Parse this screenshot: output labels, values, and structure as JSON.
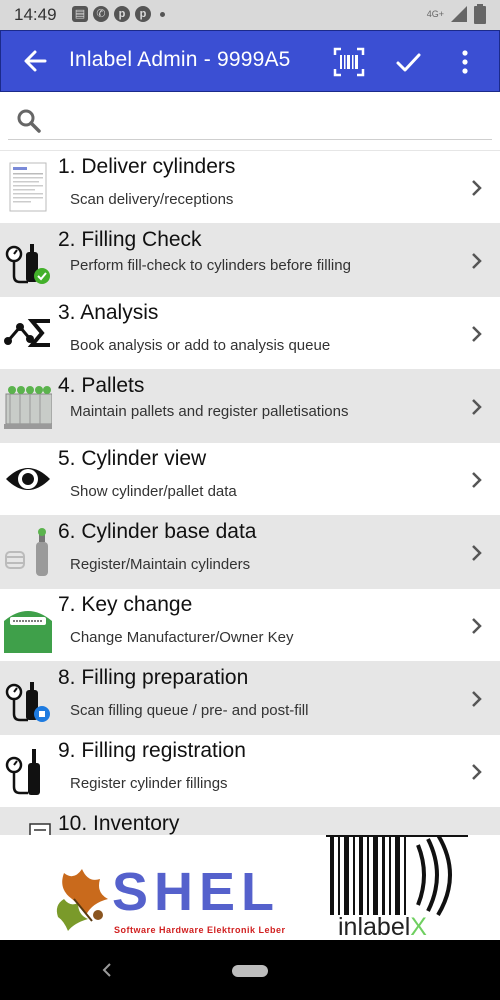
{
  "status_bar": {
    "time": "14:49",
    "network": "4G+",
    "notification_icons": [
      "message-icon",
      "whatsapp-icon",
      "pinterest-icon",
      "pinterest-icon"
    ]
  },
  "app_bar": {
    "title": "Inlabel Admin - 9999A5",
    "accent": "#3b4fd3"
  },
  "search": {
    "placeholder": ""
  },
  "menu": {
    "items": [
      {
        "title": "1. Deliver cylinders",
        "subtitle": "Scan delivery/receptions",
        "icon": "delivery-document-icon"
      },
      {
        "title": "2. Filling Check",
        "subtitle": "Perform fill-check to cylinders before filling",
        "icon": "filling-check-icon"
      },
      {
        "title": "3. Analysis",
        "subtitle": "Book analysis or add to analysis queue",
        "icon": "analysis-sigma-icon"
      },
      {
        "title": "4. Pallets",
        "subtitle": "Maintain pallets and register palletisations",
        "icon": "pallet-icon"
      },
      {
        "title": "5. Cylinder view",
        "subtitle": "Show cylinder/pallet data",
        "icon": "eye-icon"
      },
      {
        "title": "6. Cylinder base data",
        "subtitle": "Register/Maintain cylinders",
        "icon": "cylinder-icon"
      },
      {
        "title": "7. Key change",
        "subtitle": "Change Manufacturer/Owner Key",
        "icon": "cylinder-label-icon"
      },
      {
        "title": "8. Filling preparation",
        "subtitle": "Scan filling queue / pre- and post-fill",
        "icon": "filling-preparation-icon"
      },
      {
        "title": "9. Filling registration",
        "subtitle": "Register cylinder fillings",
        "icon": "filling-registration-icon"
      },
      {
        "title": "10. Inventory",
        "subtitle": "",
        "icon": "inventory-icon"
      }
    ]
  },
  "logos": {
    "shel_word": "SHEL",
    "shel_tagline": "Software Hardware Elektronik Leber",
    "inlabel_word": "inlabel",
    "inlabel_x": "X"
  }
}
